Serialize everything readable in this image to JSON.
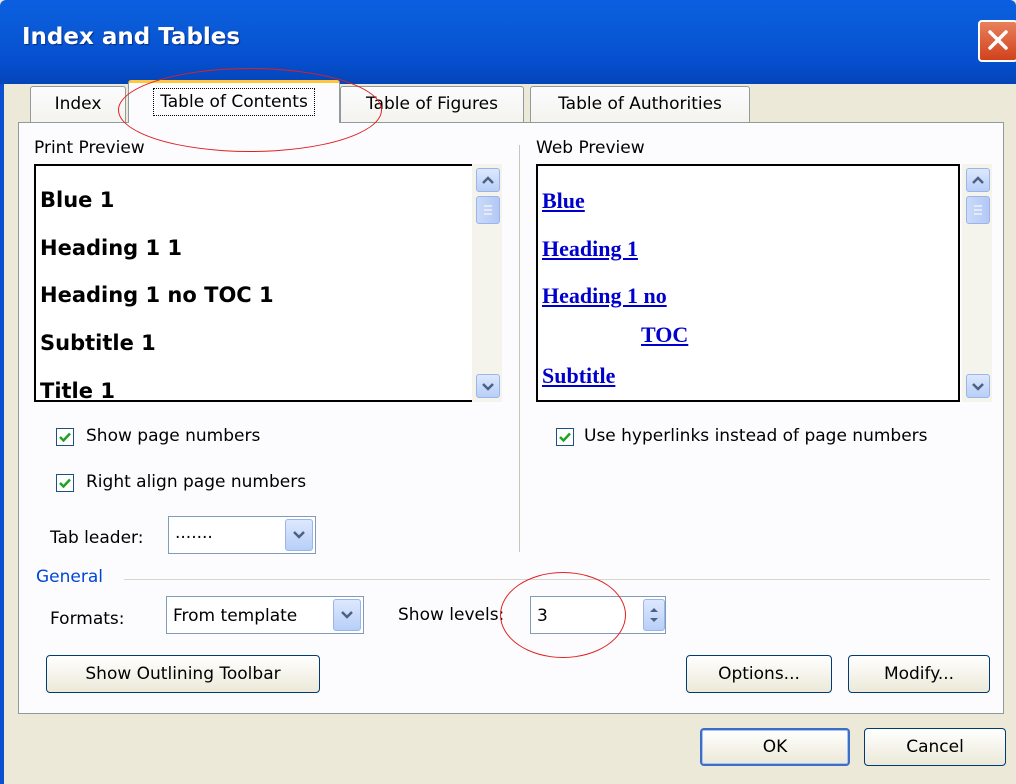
{
  "window": {
    "title": "Index and Tables"
  },
  "tabs": [
    {
      "label": "Index"
    },
    {
      "label": "Table of Contents"
    },
    {
      "label": "Table of Figures"
    },
    {
      "label": "Table of Authorities"
    }
  ],
  "print_preview": {
    "label": "Print Preview",
    "items": [
      "Blue 1",
      "Heading 1 1",
      "Heading 1 no TOC 1",
      "Subtitle 1",
      "Title 1"
    ]
  },
  "web_preview": {
    "label": "Web Preview",
    "items": [
      "Blue",
      "Heading 1",
      "Heading 1 no",
      "TOC",
      "Subtitle"
    ]
  },
  "options": {
    "show_page_numbers": {
      "label": "Show page numbers",
      "checked": true
    },
    "right_align": {
      "label": "Right align page numbers",
      "checked": true
    },
    "use_hyperlinks": {
      "label": "Use hyperlinks instead of page numbers",
      "checked": true
    },
    "tab_leader": {
      "label": "Tab leader:",
      "value": "......."
    }
  },
  "general": {
    "label": "General",
    "formats_label": "Formats:",
    "formats_value": "From template",
    "show_levels_label": "Show levels:",
    "show_levels_value": "3"
  },
  "buttons": {
    "show_outlining_toolbar": "Show Outlining Toolbar",
    "options": "Options...",
    "modify": "Modify...",
    "ok": "OK",
    "cancel": "Cancel"
  },
  "colors": {
    "accent": "#0a5fe0",
    "link": "#0000cc",
    "annotation": "#e02020"
  }
}
